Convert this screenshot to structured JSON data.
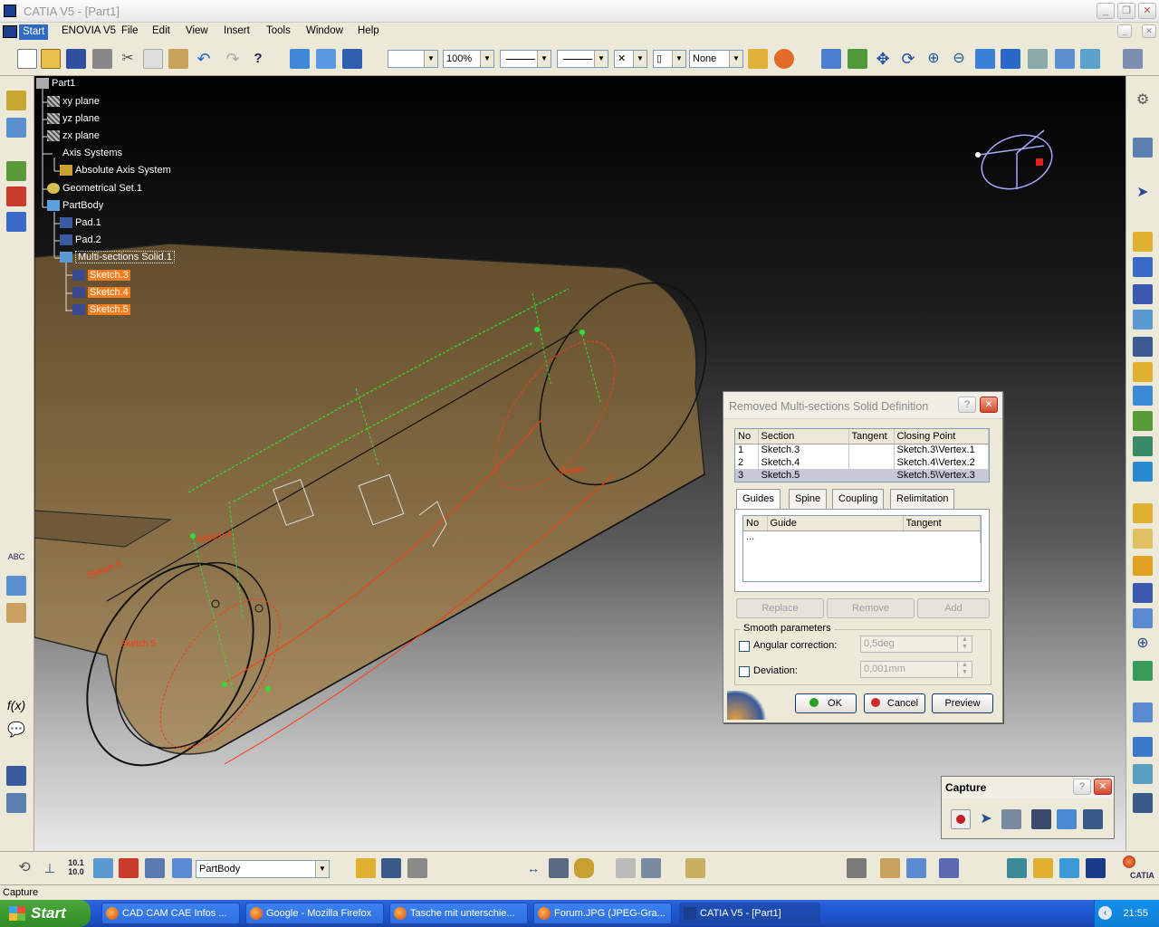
{
  "window": {
    "title": "CATIA V5 - [Part1]"
  },
  "menu": {
    "items": [
      {
        "label": "Start",
        "x": 0
      },
      {
        "label": "ENOVIA V5"
      },
      {
        "label": "File"
      },
      {
        "label": "Edit"
      },
      {
        "label": "View"
      },
      {
        "label": "Insert"
      },
      {
        "label": "Tools"
      },
      {
        "label": "Window"
      },
      {
        "label": "Help"
      }
    ]
  },
  "toolbar": {
    "zoom_combo": "100%",
    "line_none_combo": "None",
    "body_combo": "PartBody"
  },
  "tree": {
    "root": "Part1",
    "items": [
      "xy plane",
      "yz plane",
      "zx plane",
      "Axis Systems",
      "Absolute Axis System",
      "Geometrical Set.1",
      "PartBody",
      "Pad.1",
      "Pad.2",
      "Multi-sections Solid.1",
      "Sketch.3",
      "Sketch.4",
      "Sketch.5"
    ]
  },
  "dialog": {
    "title": "Removed Multi-sections Solid Definition",
    "sections_headers": [
      "No",
      "Section",
      "Tangent",
      "Closing Point"
    ],
    "sections_rows": [
      [
        "1",
        "Sketch.3",
        "",
        "Sketch.3\\Vertex.1"
      ],
      [
        "2",
        "Sketch.4",
        "",
        "Sketch.4\\Vertex.2"
      ],
      [
        "3",
        "Sketch.5",
        "",
        "Sketch.5\\Vertex.3"
      ]
    ],
    "tabs": [
      "Guides",
      "Spine",
      "Coupling",
      "Relimitation"
    ],
    "guide_headers": [
      "No",
      "Guide",
      "Tangent"
    ],
    "guide_placeholder": "...",
    "replace_label": "Replace",
    "remove_label": "Remove",
    "add_label": "Add",
    "smooth_label": "Smooth parameters",
    "angular_label": "Angular correction:",
    "angular_value": "0,5deg",
    "deviation_label": "Deviation:",
    "deviation_value": "0,001mm",
    "ok_label": "OK",
    "cancel_label": "Cancel",
    "preview_label": "Preview"
  },
  "capture": {
    "title": "Capture"
  },
  "status": {
    "text": "Capture"
  },
  "taskbar": {
    "start_label": "Start",
    "tasks": [
      "CAD CAM CAE Infos ...",
      "Google - Mozilla Firefox",
      "Tasche mit unterschie...",
      "Forum.JPG (JPEG-Gra...",
      "CATIA V5 - [Part1]"
    ],
    "clock": "21:55"
  },
  "colors": {
    "accent": "#316ac5",
    "highlight": "#f57d1f",
    "solid": "#8a6a3c",
    "sketch": "#ff3a10",
    "guide": "#33dd33"
  }
}
